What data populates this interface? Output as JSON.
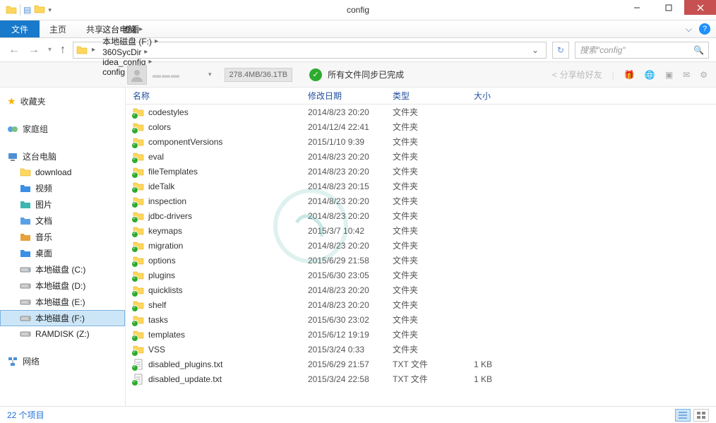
{
  "window": {
    "title": "config"
  },
  "ribbon": {
    "file": "文件",
    "tabs": [
      "主页",
      "共享",
      "查看"
    ]
  },
  "nav": {
    "crumbs": [
      "这台电脑",
      "本地磁盘 (F:)",
      "360SycDir",
      "idea_config",
      "config"
    ],
    "search_placeholder": "搜索\"config\""
  },
  "sync": {
    "quota": "278.4MB/36.1TB",
    "status": "所有文件同步已完成",
    "share": "分享给好友"
  },
  "sidebar": {
    "favorites": "收藏夹",
    "homegroup": "家庭组",
    "thispc": "这台电脑",
    "pc_items": [
      {
        "label": "download",
        "kind": "folder"
      },
      {
        "label": "视频",
        "kind": "video"
      },
      {
        "label": "图片",
        "kind": "pictures"
      },
      {
        "label": "文档",
        "kind": "docs"
      },
      {
        "label": "音乐",
        "kind": "music"
      },
      {
        "label": "桌面",
        "kind": "desktop"
      },
      {
        "label": "本地磁盘 (C:)",
        "kind": "drive-c"
      },
      {
        "label": "本地磁盘 (D:)",
        "kind": "drive"
      },
      {
        "label": "本地磁盘 (E:)",
        "kind": "drive"
      },
      {
        "label": "本地磁盘 (F:)",
        "kind": "drive",
        "selected": true
      },
      {
        "label": "RAMDISK (Z:)",
        "kind": "drive"
      }
    ],
    "network": "网络"
  },
  "columns": {
    "name": "名称",
    "date": "修改日期",
    "type": "类型",
    "size": "大小"
  },
  "files": [
    {
      "name": "codestyles",
      "date": "2014/8/23 20:20",
      "type": "文件夹",
      "size": "",
      "kind": "folder"
    },
    {
      "name": "colors",
      "date": "2014/12/4 22:41",
      "type": "文件夹",
      "size": "",
      "kind": "folder"
    },
    {
      "name": "componentVersions",
      "date": "2015/1/10 9:39",
      "type": "文件夹",
      "size": "",
      "kind": "folder"
    },
    {
      "name": "eval",
      "date": "2014/8/23 20:20",
      "type": "文件夹",
      "size": "",
      "kind": "folder"
    },
    {
      "name": "fileTemplates",
      "date": "2014/8/23 20:20",
      "type": "文件夹",
      "size": "",
      "kind": "folder"
    },
    {
      "name": "ideTalk",
      "date": "2014/8/23 20:15",
      "type": "文件夹",
      "size": "",
      "kind": "folder"
    },
    {
      "name": "inspection",
      "date": "2014/8/23 20:20",
      "type": "文件夹",
      "size": "",
      "kind": "folder"
    },
    {
      "name": "jdbc-drivers",
      "date": "2014/8/23 20:20",
      "type": "文件夹",
      "size": "",
      "kind": "folder"
    },
    {
      "name": "keymaps",
      "date": "2015/3/7 10:42",
      "type": "文件夹",
      "size": "",
      "kind": "folder"
    },
    {
      "name": "migration",
      "date": "2014/8/23 20:20",
      "type": "文件夹",
      "size": "",
      "kind": "folder"
    },
    {
      "name": "options",
      "date": "2015/6/29 21:58",
      "type": "文件夹",
      "size": "",
      "kind": "folder"
    },
    {
      "name": "plugins",
      "date": "2015/6/30 23:05",
      "type": "文件夹",
      "size": "",
      "kind": "folder"
    },
    {
      "name": "quicklists",
      "date": "2014/8/23 20:20",
      "type": "文件夹",
      "size": "",
      "kind": "folder"
    },
    {
      "name": "shelf",
      "date": "2014/8/23 20:20",
      "type": "文件夹",
      "size": "",
      "kind": "folder"
    },
    {
      "name": "tasks",
      "date": "2015/6/30 23:02",
      "type": "文件夹",
      "size": "",
      "kind": "folder"
    },
    {
      "name": "templates",
      "date": "2015/6/12 19:19",
      "type": "文件夹",
      "size": "",
      "kind": "folder"
    },
    {
      "name": "VSS",
      "date": "2015/3/24 0:33",
      "type": "文件夹",
      "size": "",
      "kind": "folder"
    },
    {
      "name": "disabled_plugins.txt",
      "date": "2015/6/29 21:57",
      "type": "TXT 文件",
      "size": "1 KB",
      "kind": "txt"
    },
    {
      "name": "disabled_update.txt",
      "date": "2015/3/24 22:58",
      "type": "TXT 文件",
      "size": "1 KB",
      "kind": "txt"
    }
  ],
  "status": {
    "count": "22 个项目"
  }
}
